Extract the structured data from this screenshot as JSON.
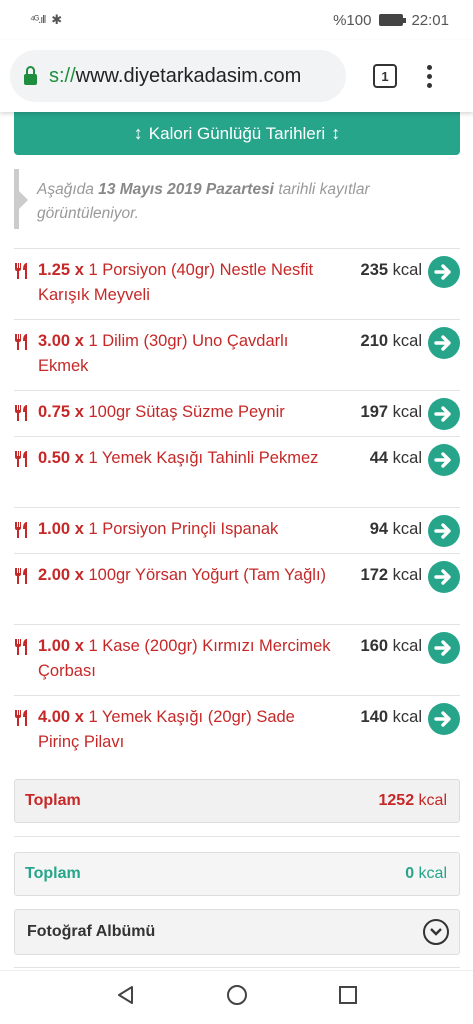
{
  "status": {
    "signal": "⁴ᴳ.ıll",
    "bluetooth": "✱",
    "battery_pct": "%100",
    "time": "22:01"
  },
  "browser": {
    "url_scheme": "s://",
    "url_host": "www.diyetarkadasim.com",
    "tab_count": "1"
  },
  "history_button": {
    "label": "Kalori Günlüğü Tarihleri"
  },
  "notice": {
    "prefix": "Aşağıda",
    "date": "13 Mayıs 2019 Pazartesi",
    "suffix": "tarihli kayıtlar görüntüleniyor."
  },
  "foods": [
    {
      "qty": "1.25 x",
      "desc": "1 Porsiyon (40gr) Nestle Nesfit Karışık Meyveli",
      "kcal": "235",
      "unit": "kcal"
    },
    {
      "qty": "3.00 x",
      "desc": "1 Dilim (30gr) Uno Çavdarlı Ekmek",
      "kcal": "210",
      "unit": "kcal"
    },
    {
      "qty": "0.75 x",
      "desc": "100gr Sütaş Süzme Peynir",
      "kcal": "197",
      "unit": "kcal"
    },
    {
      "qty": "0.50 x",
      "desc": "1 Yemek Kaşığı Tahinli Pekmez",
      "kcal": "44",
      "unit": "kcal"
    },
    {
      "qty": "1.00 x",
      "desc": "1 Porsiyon Prinçli Ispanak",
      "kcal": "94",
      "unit": "kcal"
    },
    {
      "qty": "2.00 x",
      "desc": "100gr Yörsan Yoğurt (Tam Yağlı)",
      "kcal": "172",
      "unit": "kcal"
    },
    {
      "qty": "1.00 x",
      "desc": "1 Kase (200gr) Kırmızı Mercimek Çorbası",
      "kcal": "160",
      "unit": "kcal"
    },
    {
      "qty": "4.00 x",
      "desc": "1 Yemek Kaşığı (20gr) Sade Pirinç Pilavı",
      "kcal": "140",
      "unit": "kcal"
    }
  ],
  "total_food": {
    "label": "Toplam",
    "value": "1252",
    "unit": "kcal"
  },
  "total_activity": {
    "label": "Toplam",
    "value": "0",
    "unit": "kcal"
  },
  "album": {
    "label": "Fotoğraf Albümü"
  },
  "colors": {
    "accent": "#26a58a",
    "food_red": "#c62828"
  }
}
